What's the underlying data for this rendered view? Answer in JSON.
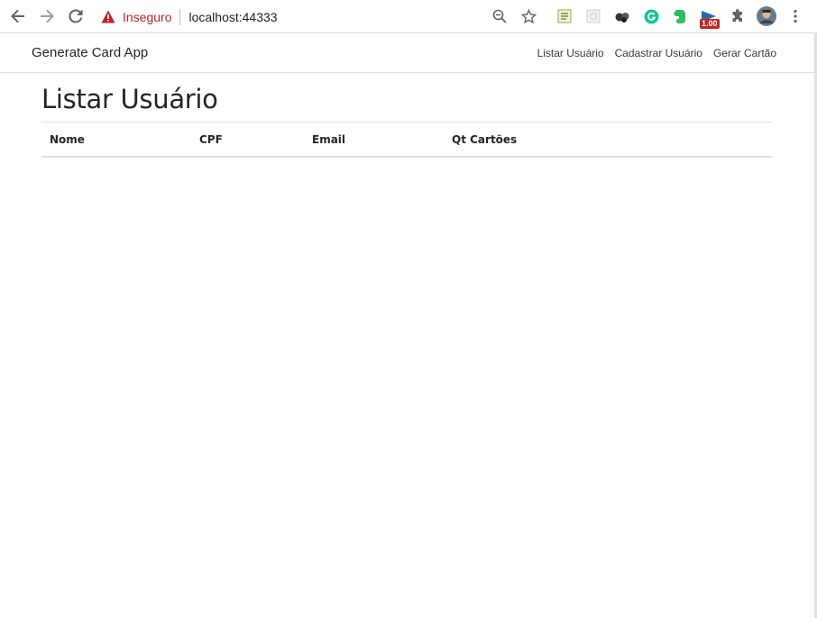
{
  "browser": {
    "security_label": "Inseguro",
    "url": "localhost:44333",
    "extension_badge": "1.00",
    "icons": [
      "back-arrow-icon",
      "forward-arrow-icon",
      "reload-icon",
      "warning-icon",
      "zoom-out-icon",
      "star-icon",
      "puzzle-icon",
      "avatar",
      "more-vert-icon"
    ]
  },
  "navbar": {
    "brand": "Generate Card App",
    "links": [
      "Listar Usuário",
      "Cadastrar Usuário",
      "Gerar Cartão"
    ]
  },
  "page": {
    "title": "Listar Usuário"
  },
  "table": {
    "columns": [
      "Nome",
      "CPF",
      "Email",
      "Qt Cartões"
    ],
    "rows": []
  },
  "colors": {
    "insecure": "#c5221f",
    "text": "#212529",
    "border": "#dee2e6"
  }
}
